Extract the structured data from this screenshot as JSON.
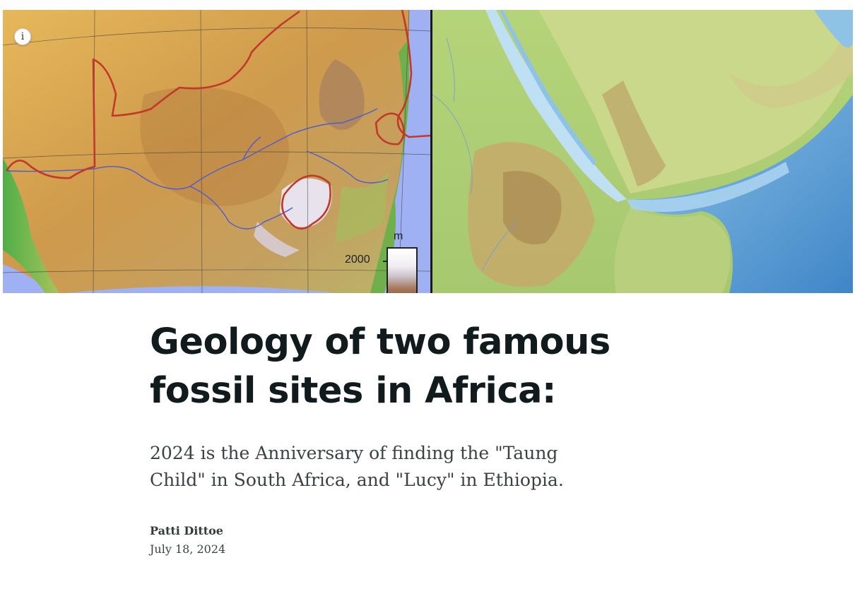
{
  "hero": {
    "info_icon_glyph": "i",
    "left_map": {
      "legend_unit": "m",
      "legend_value": "2000"
    }
  },
  "article": {
    "title": "Geology of two famous fossil sites in Africa:",
    "subtitle": "2024 is the Anniversary of finding the \"Taung Child\" in South Africa, and \"Lucy\" in Ethiopia.",
    "author": "Patti Dittoe",
    "date": "July 18, 2024"
  },
  "colors": {
    "title": "#111a1c",
    "body_text": "#3b4244",
    "border_line": "#c0392b",
    "river": "#4d5bd1",
    "ocean_left": "#9fb0f3",
    "sea_right": "#5f9fd6"
  },
  "icons": {
    "info": "info-icon"
  }
}
